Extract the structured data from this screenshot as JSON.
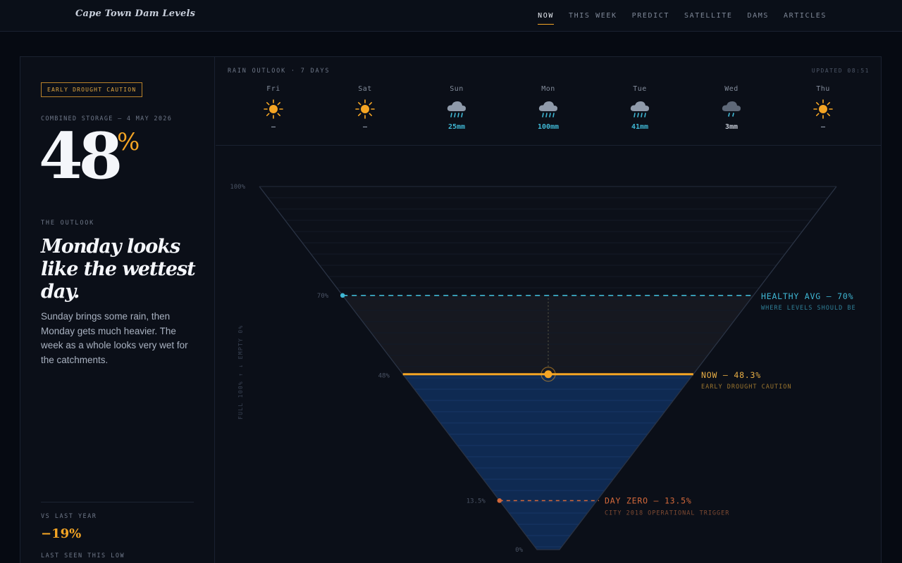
{
  "header": {
    "brand": "Cape Town Dam Levels",
    "nav": [
      {
        "label": "NOW",
        "active": true
      },
      {
        "label": "THIS WEEK",
        "active": false
      },
      {
        "label": "PREDICT",
        "active": false
      },
      {
        "label": "SATELLITE",
        "active": false
      },
      {
        "label": "DAMS",
        "active": false
      },
      {
        "label": "ARTICLES",
        "active": false
      }
    ]
  },
  "summary": {
    "badge": "EARLY DROUGHT CAUTION",
    "storage_label": "COMBINED STORAGE — 4 MAY 2026",
    "value": "48",
    "unit": "%",
    "outlook_label": "THE OUTLOOK",
    "headline": "Monday looks like the wettest day.",
    "description": "Sunday brings some rain, then Monday gets much heavier. The week as a whole looks very wet for the catchments.",
    "vs_label": "VS LAST YEAR",
    "vs_value": "−19%",
    "last_seen_label": "LAST SEEN THIS LOW"
  },
  "rain_outlook": {
    "title": "RAIN OUTLOOK · 7 DAYS",
    "updated": "UPDATED 08:51",
    "days": [
      {
        "day": "Fri",
        "icon": "sun-icon",
        "amount": "—"
      },
      {
        "day": "Sat",
        "icon": "sun-icon",
        "amount": "—"
      },
      {
        "day": "Sun",
        "icon": "rain-cloud-icon",
        "amount": "25mm"
      },
      {
        "day": "Mon",
        "icon": "rain-cloud-icon",
        "amount": "100mm"
      },
      {
        "day": "Tue",
        "icon": "rain-cloud-icon",
        "amount": "41mm"
      },
      {
        "day": "Wed",
        "icon": "light-rain-cloud-icon",
        "amount": "3mm"
      },
      {
        "day": "Thu",
        "icon": "sun-icon",
        "amount": "—"
      }
    ]
  },
  "chart_data": {
    "type": "area",
    "axis_label": "FULL 100% ↑ ↓ EMPTY 0%",
    "ylim": [
      0,
      100
    ],
    "ticks": [
      {
        "value": 100,
        "label": "100%"
      },
      {
        "value": 70,
        "label": "70%"
      },
      {
        "value": 48,
        "label": "48%"
      },
      {
        "value": 13.5,
        "label": "13.5%"
      },
      {
        "value": 0,
        "label": "0%"
      }
    ],
    "current_level": 48.3,
    "markers": [
      {
        "value": 70,
        "label": "HEALTHY AVG — 70%",
        "sublabel": "WHERE LEVELS SHOULD BE",
        "color": "#3fb7d4"
      },
      {
        "value": 48.3,
        "label": "NOW — 48.3%",
        "sublabel": "EARLY DROUGHT CAUTION",
        "color": "#f5a524"
      },
      {
        "value": 13.5,
        "label": "DAY ZERO — 13.5%",
        "sublabel": "CITY 2018 OPERATIONAL TRIGGER",
        "color": "#d3683a"
      }
    ]
  },
  "colors": {
    "accent": "#f5a524",
    "rain": "#3fb7d4",
    "water": "#0f2a52",
    "danger": "#d3683a"
  }
}
